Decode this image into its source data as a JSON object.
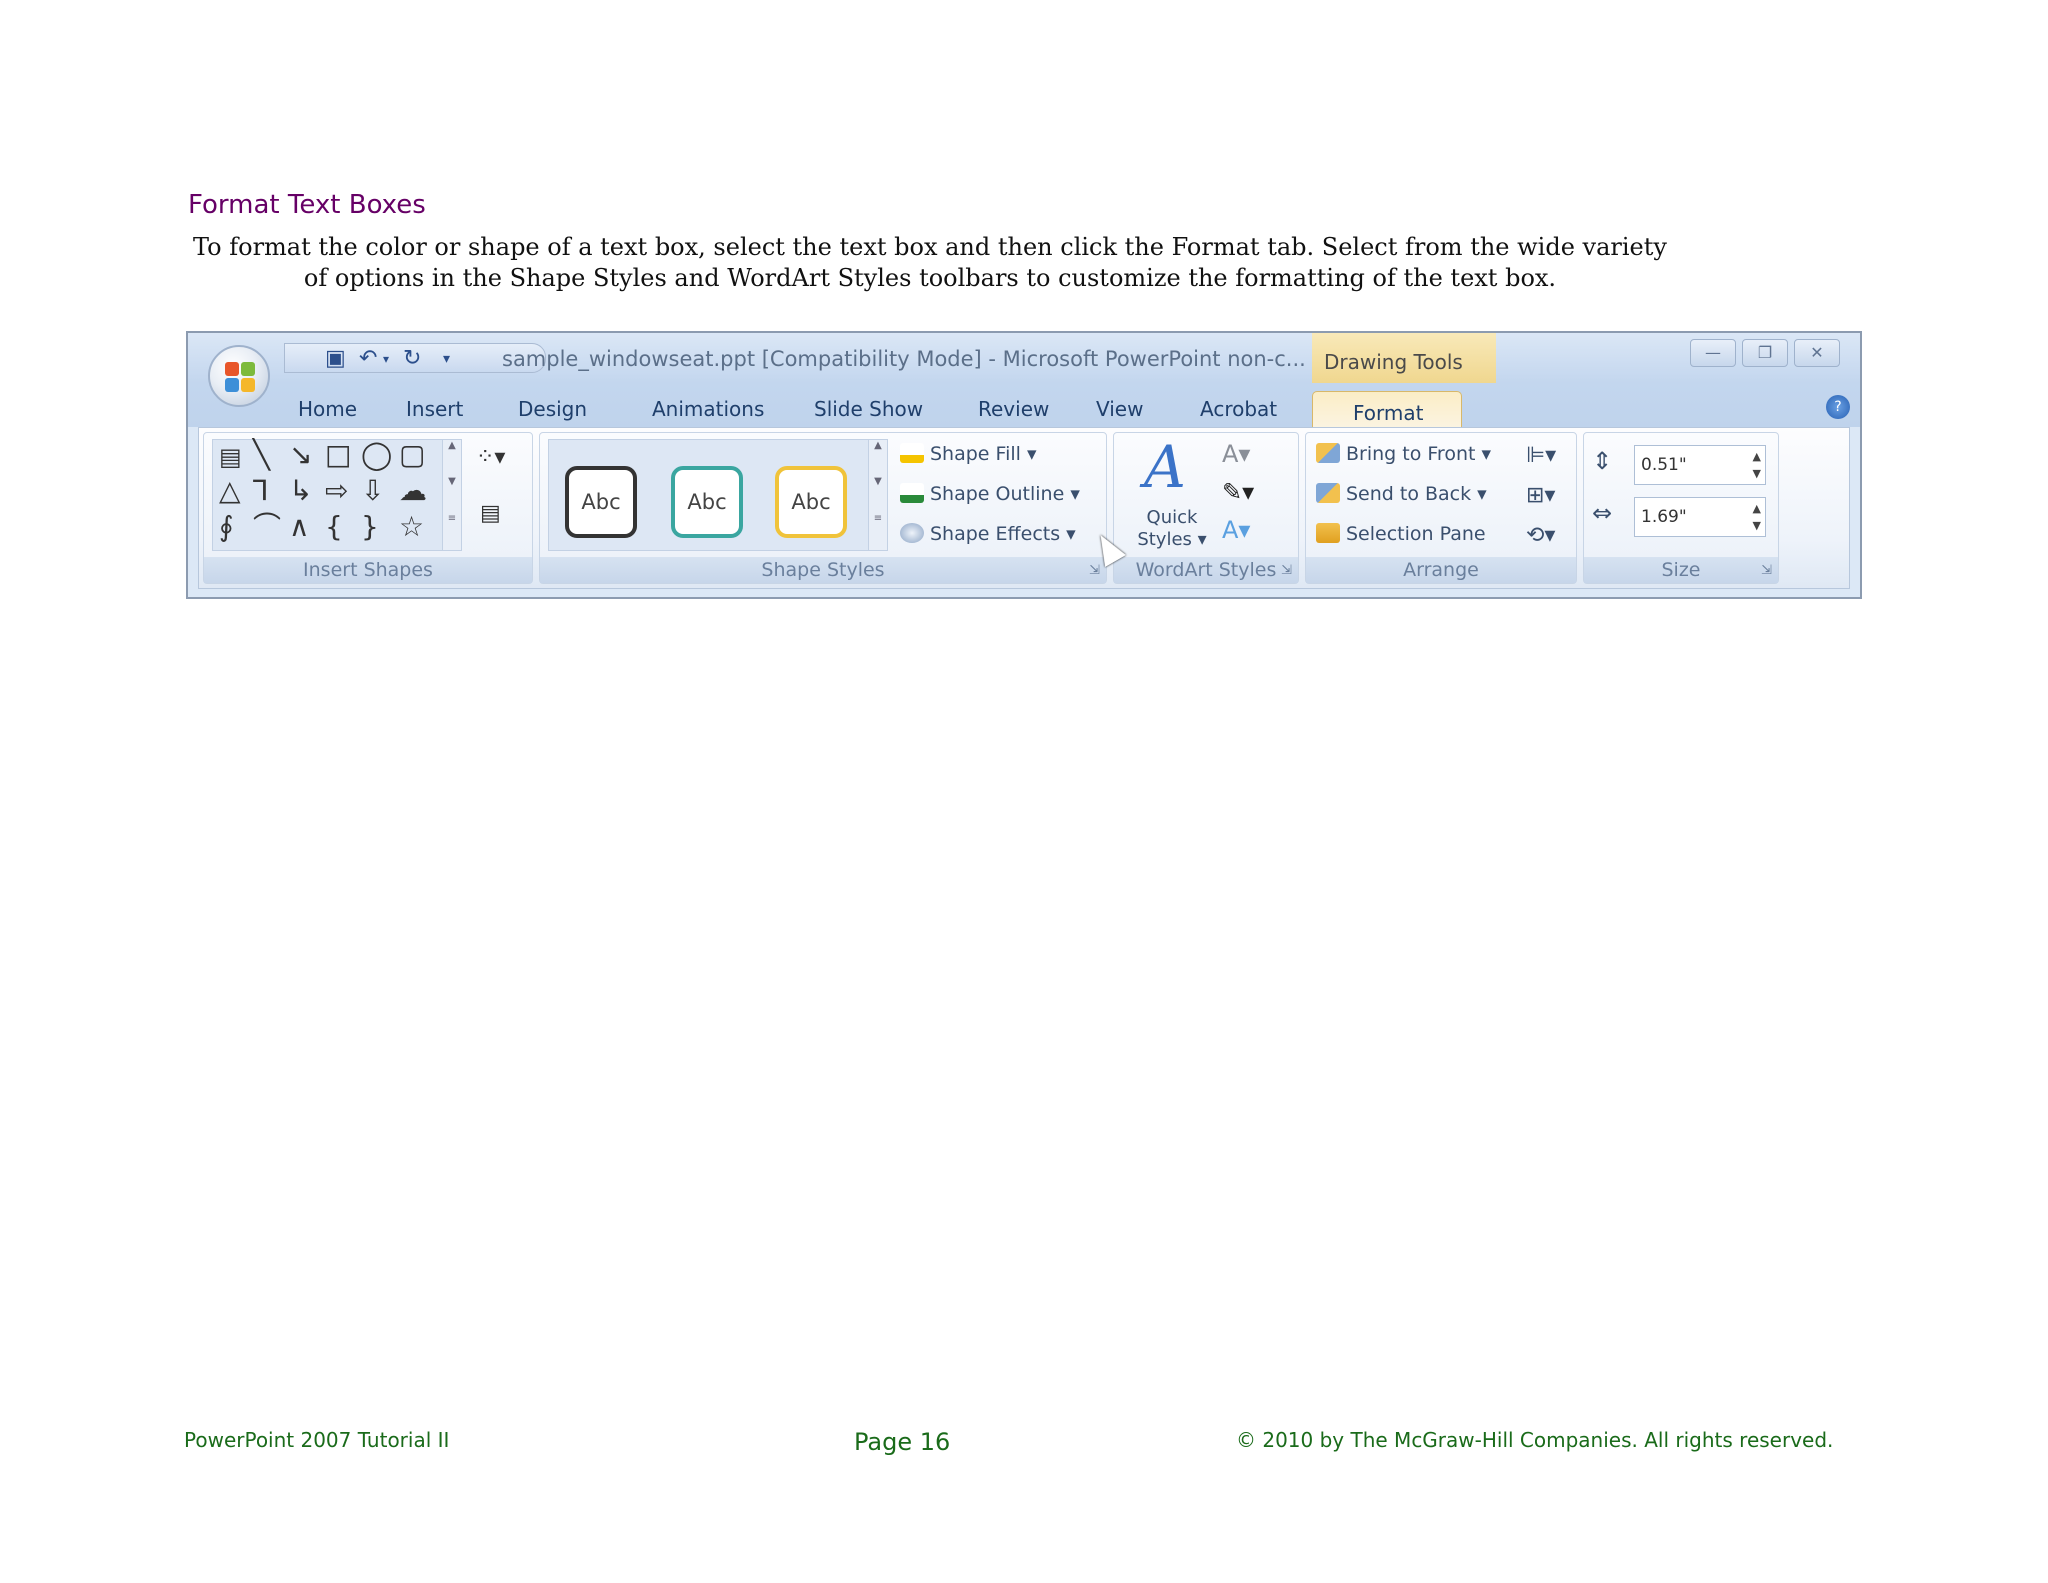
{
  "page": {
    "heading": "Format Text Boxes",
    "intro": "To format the color or shape of a text box, select the text box and then click the Format tab. Select from the wide variety of options in the Shape Styles and WordArt Styles toolbars to customize the formatting of the text box."
  },
  "window": {
    "title": "sample_windowseat.ppt [Compatibility Mode] - Microsoft PowerPoint non-c...",
    "context_title": "Drawing Tools",
    "buttons": {
      "minimize": "—",
      "restore": "❐",
      "close": "✕"
    }
  },
  "tabs": [
    "Home",
    "Insert",
    "Design",
    "Animations",
    "Slide Show",
    "Review",
    "View",
    "Acrobat",
    "Format"
  ],
  "groups": {
    "insert_shapes": "Insert Shapes",
    "shape_styles": "Shape Styles",
    "wordart_styles": "WordArt Styles",
    "arrange": "Arrange",
    "size": "Size"
  },
  "shape_styles": {
    "preset_label": "Abc",
    "presets": [
      {
        "border": "#333333"
      },
      {
        "border": "#3aa6a0"
      },
      {
        "border": "#f0c33a"
      }
    ],
    "fill": "Shape Fill",
    "outline": "Shape Outline",
    "effects": "Shape Effects"
  },
  "wordart": {
    "quick_styles_line1": "Quick",
    "quick_styles_line2": "Styles"
  },
  "arrange": {
    "bring_front": "Bring to Front",
    "send_back": "Send to Back",
    "selection_pane": "Selection Pane"
  },
  "size": {
    "height": "0.51\"",
    "width": "1.69\""
  },
  "footer": {
    "left": "PowerPoint 2007 Tutorial II",
    "center": "Page 16",
    "right": "© 2010 by The McGraw-Hill Companies. All rights reserved."
  }
}
